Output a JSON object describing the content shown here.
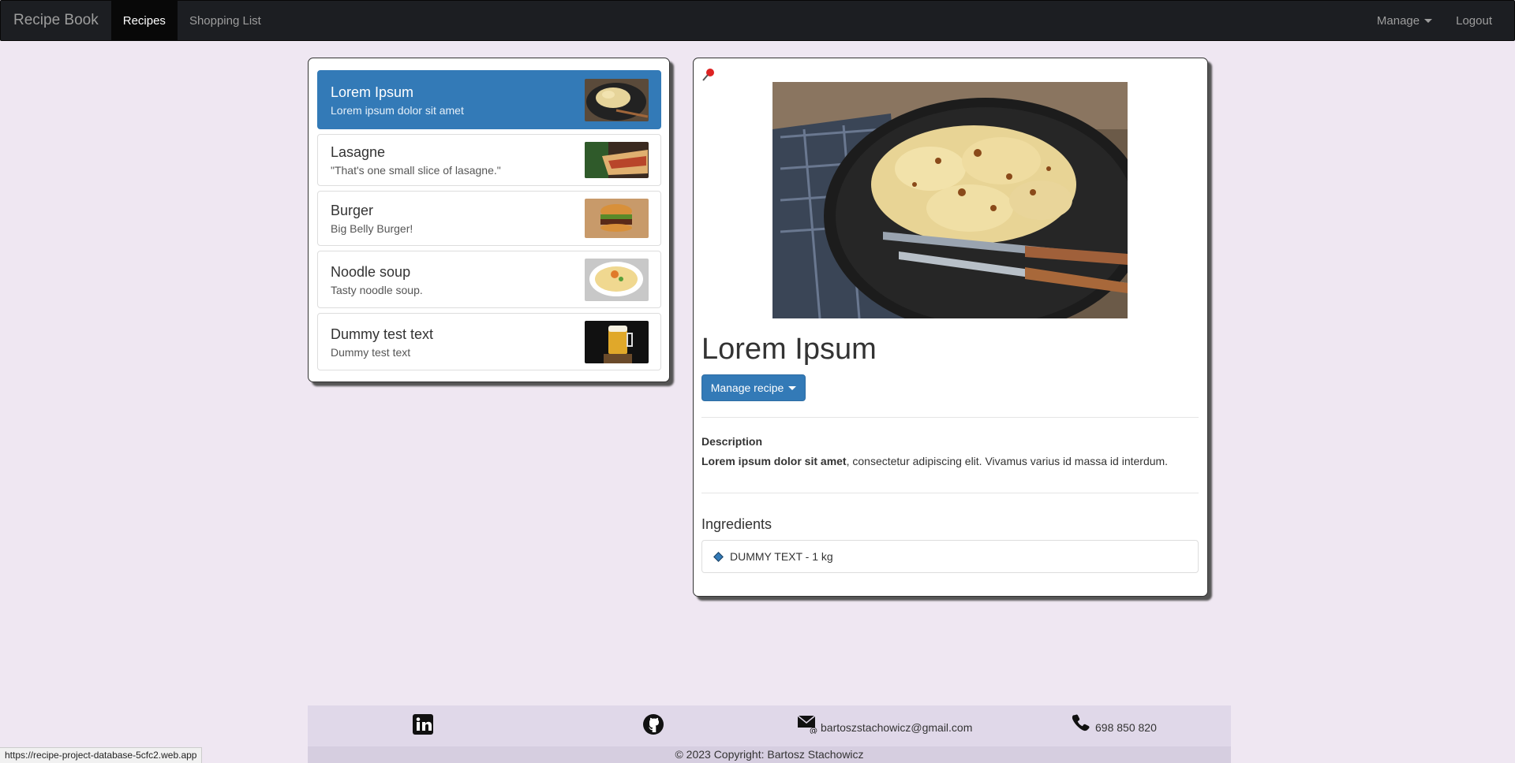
{
  "navbar": {
    "brand": "Recipe Book",
    "links": [
      "Recipes",
      "Shopping List"
    ],
    "manage_label": "Manage",
    "logout_label": "Logout"
  },
  "recipes": [
    {
      "name": "Lorem Ipsum",
      "description": "Lorem ipsum dolor sit amet",
      "active": true
    },
    {
      "name": "Lasagne",
      "description": "\"That's one small slice of lasagne.\"",
      "active": false
    },
    {
      "name": "Burger",
      "description": "Big Belly Burger!",
      "active": false
    },
    {
      "name": "Noodle soup",
      "description": "Tasty noodle soup.",
      "active": false
    },
    {
      "name": "Dummy test text",
      "description": "Dummy test text",
      "active": false
    }
  ],
  "detail": {
    "title": "Lorem Ipsum",
    "manage_button": "Manage recipe",
    "description_heading": "Description",
    "description_bold": "Lorem ipsum dolor sit amet",
    "description_rest": ", consectetur adipiscing elit. Vivamus varius id massa id interdum.",
    "ingredients_heading": "Ingredients",
    "ingredients": [
      "DUMMY TEXT - 1 kg"
    ]
  },
  "footer": {
    "email": "bartoszstachowicz@gmail.com",
    "phone": "698 850 820",
    "copyright": "© 2023 Copyright: Bartosz Stachowicz"
  },
  "status_url": "https://recipe-project-database-5cfc2.web.app",
  "colors": {
    "accent": "#337ab7",
    "navbar": "#1c1e22",
    "background": "#efe7f2"
  }
}
